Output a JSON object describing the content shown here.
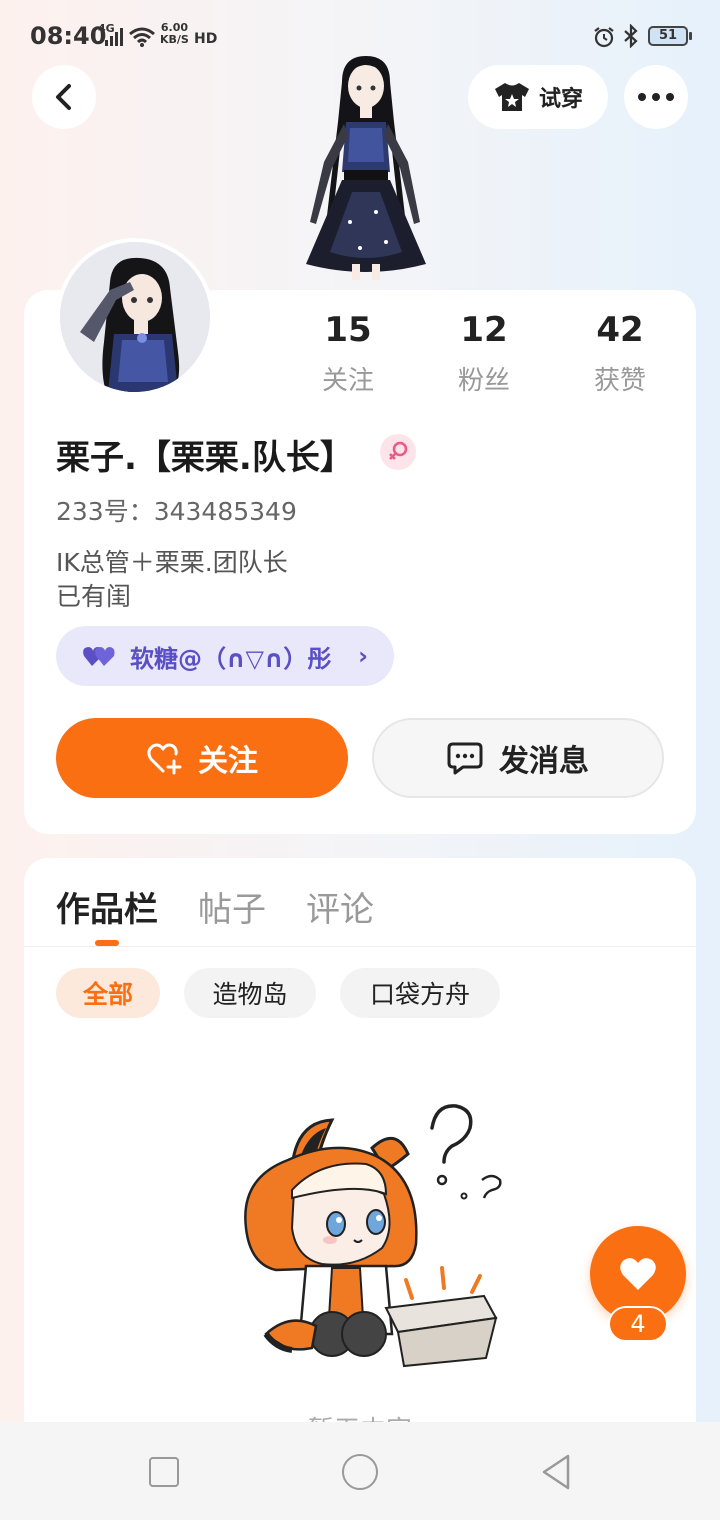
{
  "status_bar": {
    "time": "08:40",
    "network": "4G",
    "speed_value": "6.00",
    "speed_unit": "KB/S",
    "hd": "HD",
    "battery": "51"
  },
  "header": {
    "try_on_label": "试穿",
    "icons": [
      "back-arrow-icon",
      "tshirt-icon",
      "more-dots-icon"
    ]
  },
  "profile": {
    "name": "栗子.【栗栗.队长】",
    "gender": "female",
    "uid": "233号：343485349",
    "bio_line1": "IK总管＋栗栗.团队长",
    "bio_line2": "已有闺",
    "cp_label": "软糖@（∩▽∩）彤",
    "stats": [
      {
        "num": "15",
        "label": "关注"
      },
      {
        "num": "12",
        "label": "粉丝"
      },
      {
        "num": "42",
        "label": "获赞"
      }
    ],
    "follow_label": "关注",
    "message_label": "发消息"
  },
  "tabs": [
    {
      "label": "作品栏",
      "active": true
    },
    {
      "label": "帖子",
      "active": false
    },
    {
      "label": "评论",
      "active": false
    }
  ],
  "filters": [
    {
      "label": "全部",
      "active": true
    },
    {
      "label": "造物岛",
      "active": false
    },
    {
      "label": "口袋方舟",
      "active": false
    }
  ],
  "empty_state_text": "暂无内容",
  "like": {
    "count": "4"
  },
  "colors": {
    "accent": "#fa6f12",
    "cp_text": "#5a4fc4",
    "cp_bg": "#e9e8fb"
  }
}
